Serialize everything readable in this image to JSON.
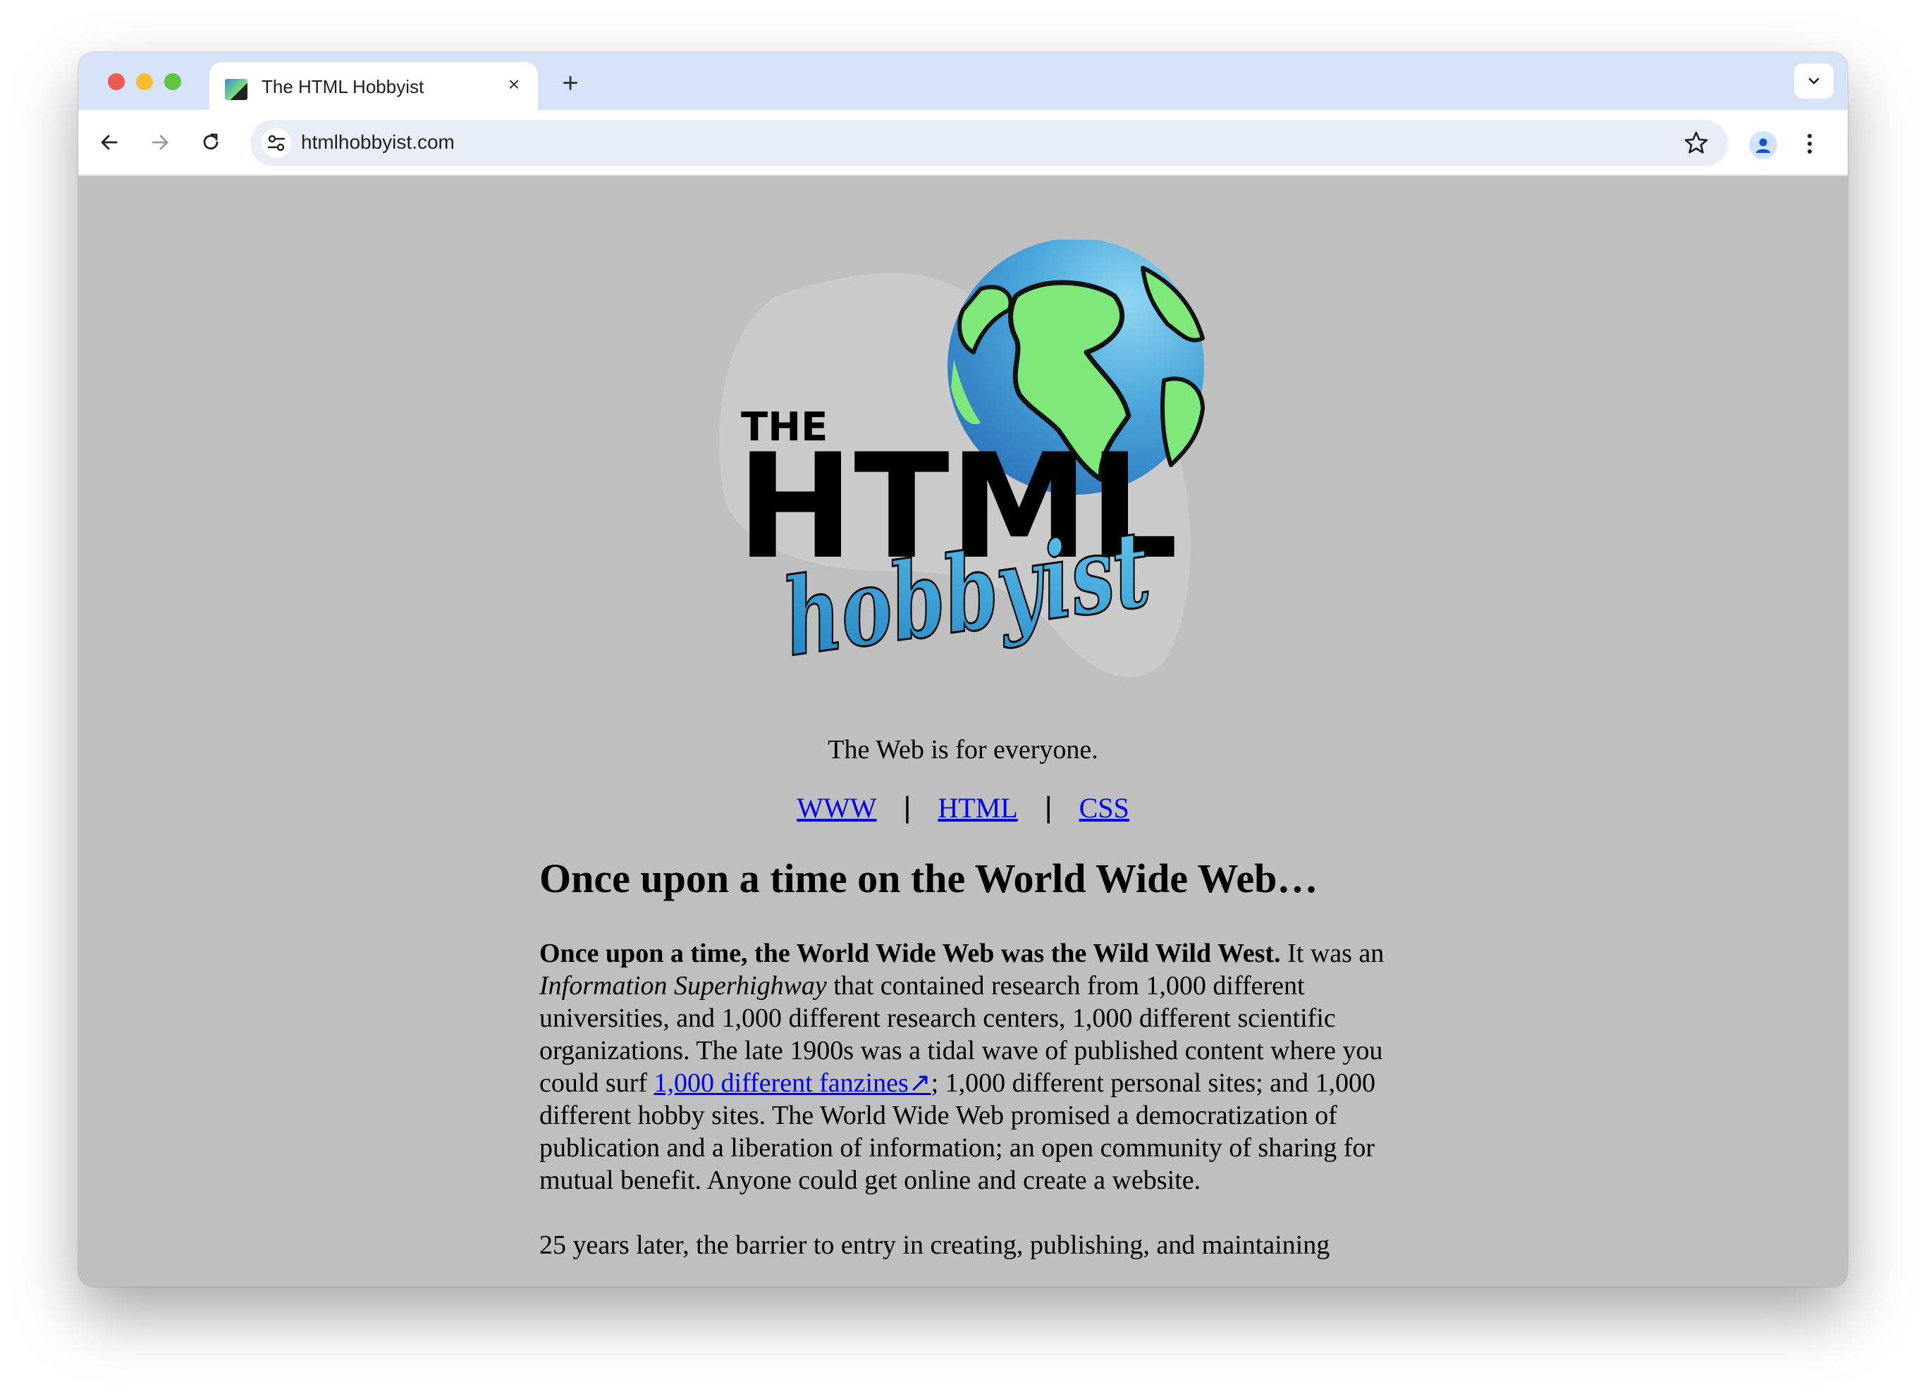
{
  "browser": {
    "tab_title": "The HTML Hobbyist",
    "url": "htmlhobbyist.com",
    "new_tab_label": "+",
    "close_tab_label": "×"
  },
  "logo": {
    "word_the": "THE",
    "word_html": "HTML",
    "word_hobbyist": "hobbyist"
  },
  "page": {
    "tagline": "The Web is for everyone.",
    "nav": [
      {
        "label": "WWW"
      },
      {
        "label": "HTML"
      },
      {
        "label": "CSS"
      }
    ],
    "separator": "|",
    "heading": "Once upon a time on the World Wide Web…",
    "p1_bold": "Once upon a time, the World Wide Web was the Wild Wild West.",
    "p1_a": " It was an ",
    "p1_italic": "Information Superhighway",
    "p1_b": " that contained research from 1,000 different universities, and 1,000 different research centers, 1,000 different scientific organizations. The late 1900s was a tidal wave of published content where you could surf ",
    "p1_link": "1,000 different fanzines↗",
    "p1_c": "; 1,000 different personal sites; and 1,000 different hobby sites. The World Wide Web promised a democratization of publication and a liberation of information; an open community of sharing for mutual benefit. Anyone could get online and create a website.",
    "p2": "25 years later, the barrier to entry in creating, publishing, and maintaining"
  },
  "colors": {
    "page_bg": "#bfbfbf",
    "link": "#0000ee",
    "tabstrip": "#d6e2f8",
    "globe_ocean": "#3f9bd8",
    "globe_land": "#7ee87a",
    "hobbyist_blue": "#3aa0d8"
  }
}
